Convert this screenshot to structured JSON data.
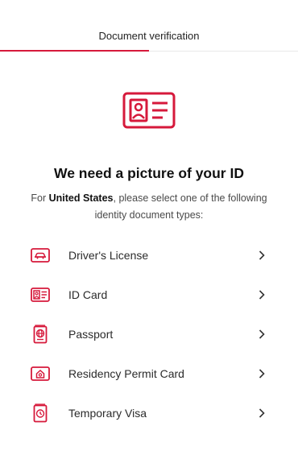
{
  "header": {
    "title": "Document verification",
    "progress": 0.5
  },
  "hero": {
    "icon": "id-card-icon"
  },
  "headline": "We need a picture of your ID",
  "instructions": {
    "prefix": "For ",
    "country": "United States",
    "suffix": ", please select one of the following identity document types:"
  },
  "documents": [
    {
      "label": "Driver's License",
      "icon": "car-icon"
    },
    {
      "label": "ID Card",
      "icon": "id-card-icon"
    },
    {
      "label": "Passport",
      "icon": "passport-icon"
    },
    {
      "label": "Residency Permit Card",
      "icon": "house-card-icon"
    },
    {
      "label": "Temporary Visa",
      "icon": "visa-icon"
    }
  ],
  "colors": {
    "accent": "#d6193b",
    "text": "#2b2b2b",
    "muted": "#4a4a4a"
  }
}
